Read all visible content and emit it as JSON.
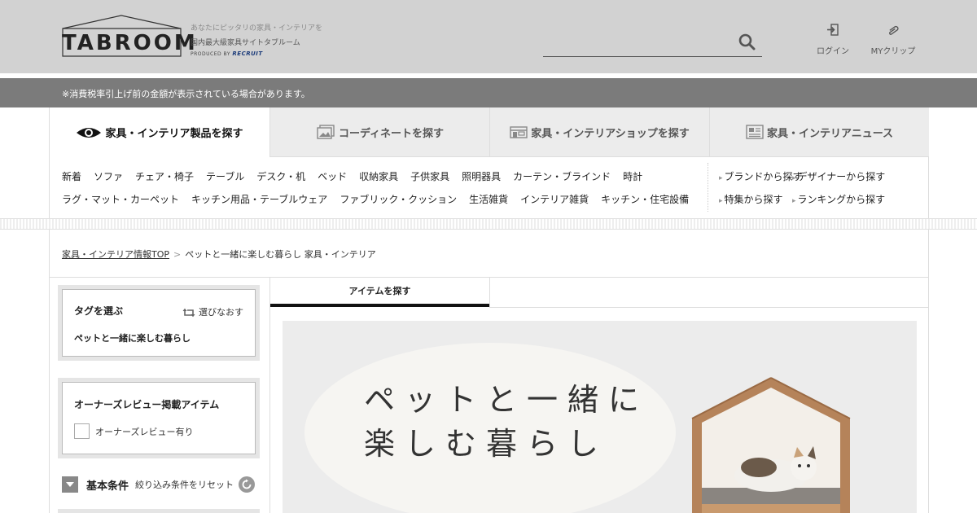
{
  "header": {
    "logo_text": "TABROOM",
    "tagline_1": "あなたにピッタリの家具・インテリアを",
    "tagline_2": "国内最大級家具サイトタブルーム",
    "produced_by": "PRODUCED BY",
    "produced_brand": "RECRUIT",
    "search_placeholder": "",
    "login_label": "ログイン",
    "clip_label": "MYクリップ"
  },
  "notice": "※消費税率引上げ前の金額が表示されている場合があります。",
  "nav_tabs": [
    {
      "label": "家具・インテリア製品を探す",
      "icon": "eye-icon",
      "active": true
    },
    {
      "label": "コーディネートを探す",
      "icon": "photos-icon",
      "active": false
    },
    {
      "label": "家具・インテリアショップを探す",
      "icon": "shop-icon",
      "active": false
    },
    {
      "label": "家具・インテリアニュース",
      "icon": "news-icon",
      "active": false
    }
  ],
  "categories_row1": [
    "新着",
    "ソファ",
    "チェア・椅子",
    "テーブル",
    "デスク・机",
    "ベッド",
    "収納家具",
    "子供家具",
    "照明器具",
    "カーテン・ブラインド",
    "時計"
  ],
  "categories_row2": [
    "ラグ・マット・カーペット",
    "キッチン用品・テーブルウェア",
    "ファブリック・クッション",
    "生活雑貨",
    "インテリア雑貨",
    "キッチン・住宅設備"
  ],
  "side_links": [
    "ブランドから探す",
    "デザイナーから探す",
    "特集から探す",
    "ランキングから探す"
  ],
  "breadcrumb": {
    "home": "家具・インテリア情報TOP",
    "separator": ">",
    "current": "ペットと一緒に楽しむ暮らし 家具・インテリア"
  },
  "sidebar": {
    "tag_title": "タグを選ぶ",
    "tag_reset": "選びなおす",
    "tag_selected": "ペットと一緒に楽しむ暮らし",
    "review_title": "オーナーズレビュー掲載アイテム",
    "review_checkbox": "オーナーズレビュー有り",
    "basic_title": "基本条件",
    "basic_reset": "絞り込み条件をリセット"
  },
  "main": {
    "item_tab": "アイテムを探す",
    "hero_line1": "ペットと一緒に",
    "hero_line2": "楽しむ暮らし"
  }
}
